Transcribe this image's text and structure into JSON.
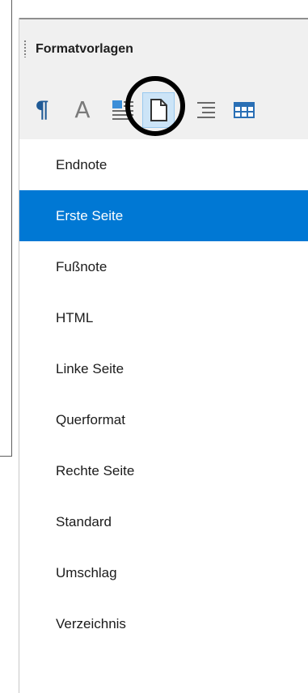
{
  "panel": {
    "title": "Formatvorlagen"
  },
  "toolbar": {
    "buttons": [
      {
        "name": "paragraph-styles",
        "icon": "pilcrow-icon",
        "glyph": "¶"
      },
      {
        "name": "character-styles",
        "icon": "character-a-icon",
        "glyph": "A"
      },
      {
        "name": "frame-styles",
        "icon": "frame-icon"
      },
      {
        "name": "page-styles",
        "icon": "page-icon",
        "active": true
      },
      {
        "name": "list-styles",
        "icon": "list-icon"
      },
      {
        "name": "table-styles",
        "icon": "table-icon"
      }
    ]
  },
  "styles": {
    "items": [
      {
        "label": "Endnote"
      },
      {
        "label": "Erste Seite"
      },
      {
        "label": "Fußnote"
      },
      {
        "label": "HTML"
      },
      {
        "label": "Linke Seite"
      },
      {
        "label": "Querformat"
      },
      {
        "label": "Rechte Seite"
      },
      {
        "label": "Standard"
      },
      {
        "label": "Umschlag"
      },
      {
        "label": "Verzeichnis"
      }
    ],
    "selected_label": "Erste Seite"
  },
  "colors": {
    "selection": "#0078d4",
    "active_button_bg": "#cce4f7",
    "pilcrow": "#1f5a96",
    "highlight_ring": "#000000"
  }
}
